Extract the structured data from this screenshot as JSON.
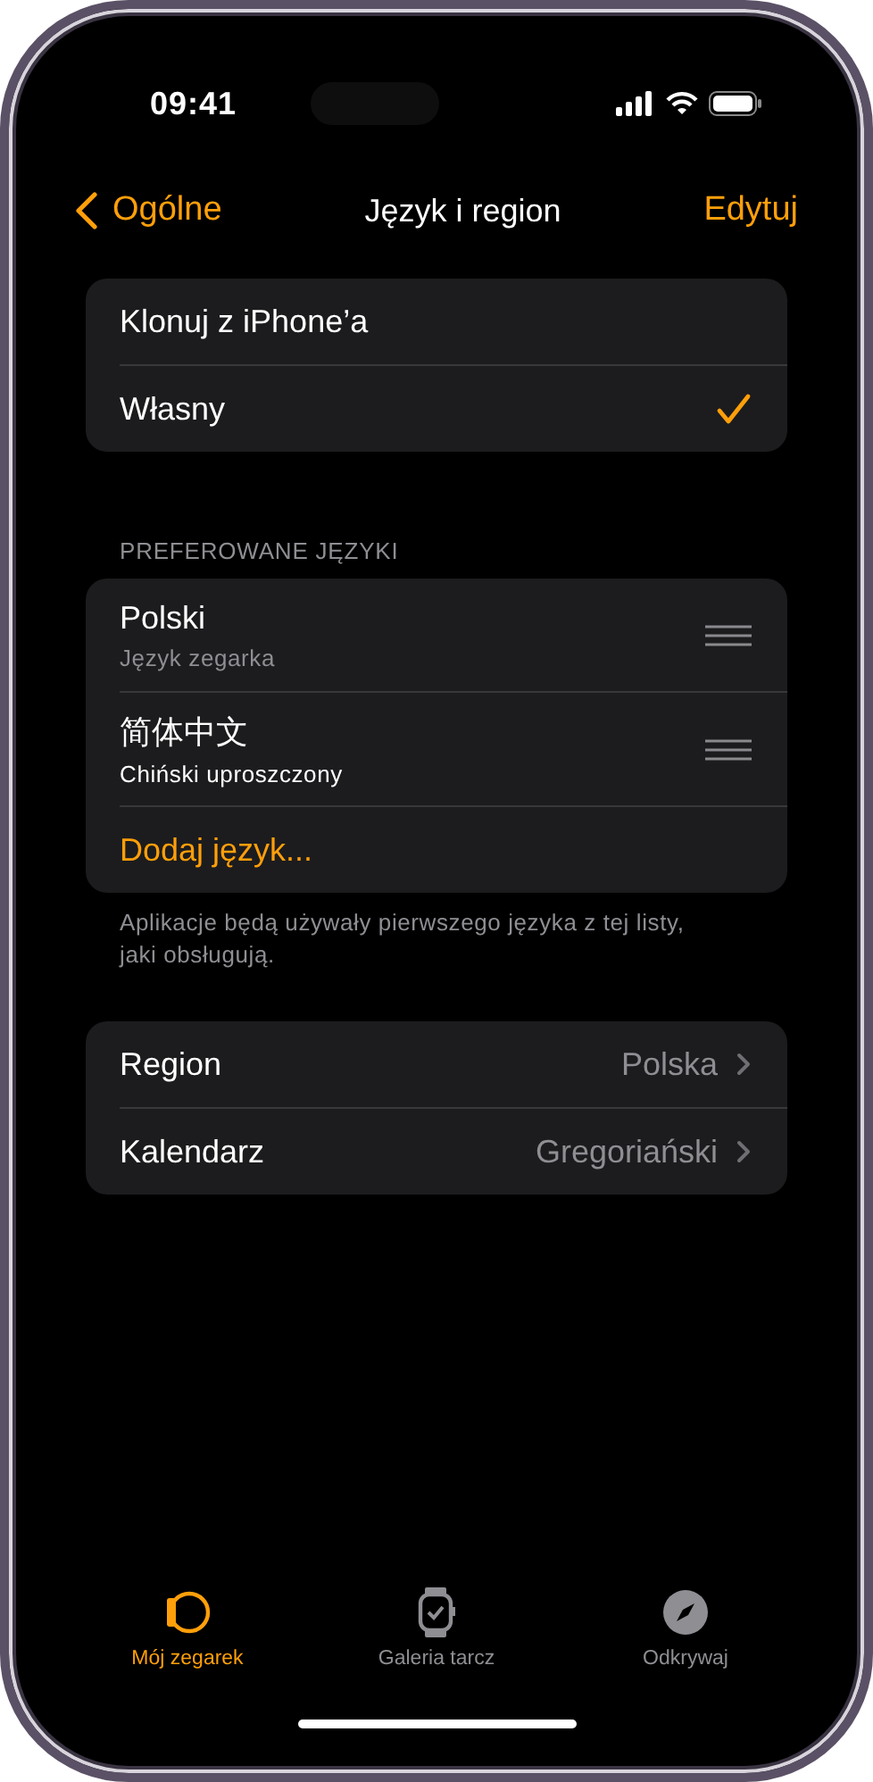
{
  "status_bar": {
    "time": "09:41"
  },
  "nav": {
    "back": "Ogólne",
    "title": "Język i region",
    "action": "Edytuj"
  },
  "mode_options": [
    {
      "label": "Klonuj z iPhone’a",
      "selected": false
    },
    {
      "label": "Własny",
      "selected": true
    }
  ],
  "languages": {
    "header": "PREFEROWANE JĘZYKI",
    "items": [
      {
        "name": "Polski",
        "subtitle": "Język zegarka",
        "dim": true
      },
      {
        "name": "简体中文",
        "subtitle": "Chiński uproszczony",
        "dim": false
      }
    ],
    "add": "Dodaj język...",
    "footnote": "Aplikacje będą używały pierwszego języka z tej listy, jaki obsługują."
  },
  "settings": [
    {
      "label": "Region",
      "value": "Polska"
    },
    {
      "label": "Kalendarz",
      "value": "Gregoriański"
    }
  ],
  "tabs": [
    {
      "label": "Mój zegarek",
      "kind": "my-watch",
      "selected": true
    },
    {
      "label": "Galeria tarcz",
      "kind": "face-gallery",
      "selected": false
    },
    {
      "label": "Odkrywaj",
      "kind": "discover",
      "selected": false
    }
  ]
}
